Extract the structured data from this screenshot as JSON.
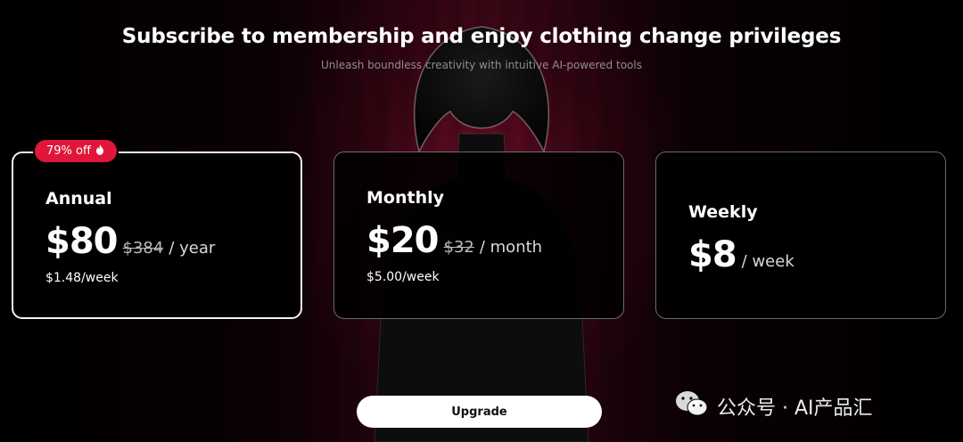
{
  "header": {
    "title": "Subscribe to membership and enjoy clothing change privileges",
    "subtitle": "Unleash boundless creativity with intuitive AI-powered tools"
  },
  "plans": [
    {
      "badge": "79% off",
      "name": "Annual",
      "price": "$80",
      "old_price": "$384",
      "period": "/ year",
      "per_week": "$1.48/week",
      "selected": true
    },
    {
      "name": "Monthly",
      "price": "$20",
      "old_price": "$32",
      "period": "/ month",
      "per_week": "$5.00/week",
      "selected": false
    },
    {
      "name": "Weekly",
      "price": "$8",
      "period": "/ week",
      "selected": false
    }
  ],
  "upgrade_label": "Upgrade",
  "watermark": "公众号 · AI产品汇",
  "colors": {
    "badge": "#e0163a",
    "background": "#000000",
    "accent_glow": "#3a0616"
  },
  "icons": {
    "badge": "flame-icon",
    "watermark": "wechat-icon"
  }
}
